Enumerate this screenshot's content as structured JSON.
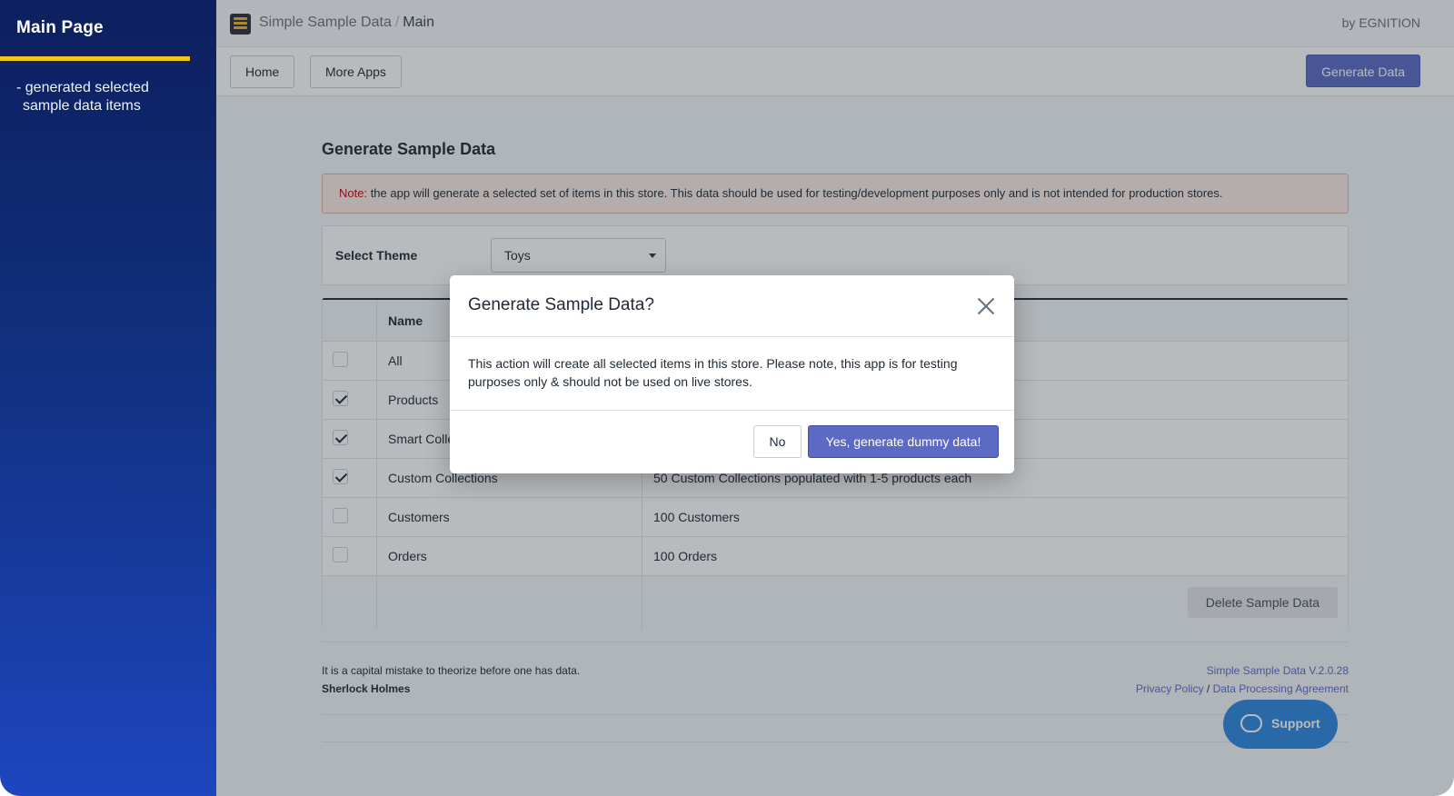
{
  "sidebar": {
    "title": "Main Page",
    "description_line1": "- generated selected",
    "description_line2": "sample data items"
  },
  "header": {
    "app_name": "Simple Sample Data",
    "separator": "/",
    "current_page": "Main",
    "by_line": "by EGNITION",
    "logo_icon": "stacked-layers-icon"
  },
  "nav": {
    "home_label": "Home",
    "more_apps_label": "More Apps",
    "generate_label": "Generate Data"
  },
  "main": {
    "section_title": "Generate Sample Data",
    "note_label": "Note:",
    "note_text": " the app will generate a selected set of items in this store. This data should be used for testing/development purposes only and is not intended for production stores.",
    "theme_label": "Select Theme",
    "theme_value": "Toys",
    "table": {
      "header_name": "Name",
      "rows": [
        {
          "checked": false,
          "name": "All",
          "description": ""
        },
        {
          "checked": true,
          "name": "Products",
          "description": ""
        },
        {
          "checked": true,
          "name": "Smart Colle",
          "description": ""
        },
        {
          "checked": true,
          "name": "Custom Collections",
          "description": "50 Custom Collections populated with 1-5 products each"
        },
        {
          "checked": false,
          "name": "Customers",
          "description": "100 Customers"
        },
        {
          "checked": false,
          "name": "Orders",
          "description": "100 Orders"
        }
      ],
      "delete_label": "Delete Sample Data"
    },
    "quote_text": "It is a capital mistake to theorize before one has data.",
    "quote_author": "Sherlock Holmes",
    "version_link": "Simple Sample Data V.2.0.28",
    "privacy_link": "Privacy Policy",
    "links_separator": " / ",
    "dpa_link": "Data Processing Agreement",
    "support_label": "Support"
  },
  "modal": {
    "title": "Generate Sample Data?",
    "body": "This action will create all selected items in this store. Please note, this app is for testing purposes only & should not be used on live stores.",
    "no_label": "No",
    "yes_label": "Yes, generate dummy data!"
  },
  "colors": {
    "sidebar_top": "#0d1f5e",
    "sidebar_bottom": "#1d46bf",
    "accent_rule": "#f5c518",
    "primary_button": "#5c6ac4",
    "support_button": "#2f86de",
    "note_label": "#bf0711"
  }
}
